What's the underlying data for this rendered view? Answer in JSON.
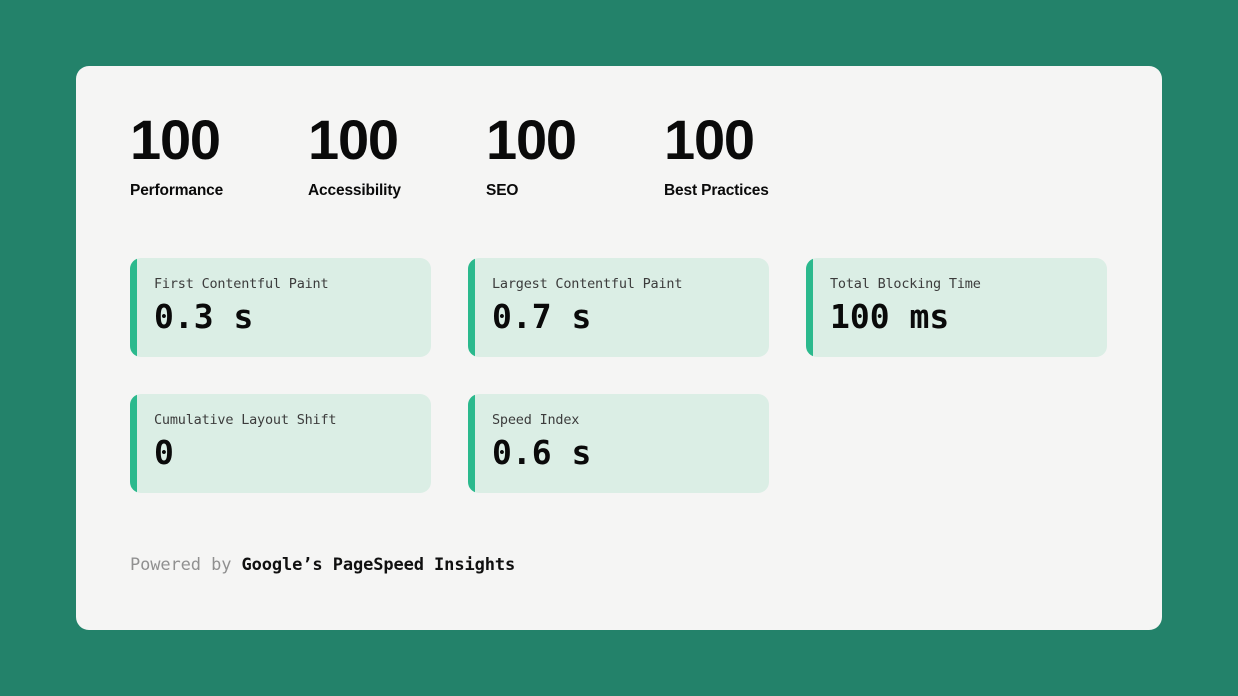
{
  "theme": {
    "page_background": "#23826a",
    "panel_background": "#f5f5f4",
    "card_background": "#dbeee5",
    "card_accent": "#2bb98d",
    "score_text": "#0a0a0a",
    "card_label_text": "#3c3c3c",
    "footer_muted_text": "#909090"
  },
  "scores": [
    {
      "value": "100",
      "label": "Performance"
    },
    {
      "value": "100",
      "label": "Accessibility"
    },
    {
      "value": "100",
      "label": "SEO"
    },
    {
      "value": "100",
      "label": "Best Practices"
    }
  ],
  "metrics": [
    {
      "label": "First Contentful Paint",
      "value": "0.3 s"
    },
    {
      "label": "Largest Contentful Paint",
      "value": "0.7 s"
    },
    {
      "label": "Total Blocking Time",
      "value": "100 ms"
    },
    {
      "label": "Cumulative Layout Shift",
      "value": "0"
    },
    {
      "label": "Speed Index",
      "value": "0.6 s"
    }
  ],
  "footer": {
    "prefix": "Powered by ",
    "brand": "Google’s PageSpeed Insights"
  }
}
